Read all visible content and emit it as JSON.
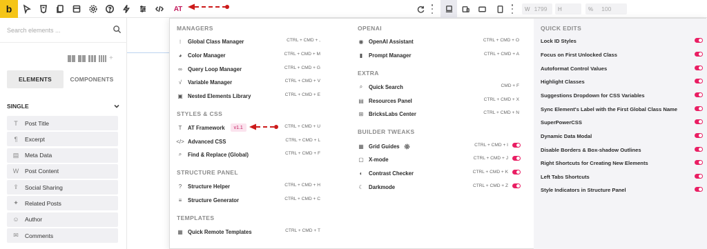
{
  "toolbar": {
    "logo": "b",
    "at_label": "AT",
    "width_label": "W",
    "width_value": "1799",
    "height_label": "H",
    "scale_label": "%",
    "scale_value": "100"
  },
  "sidebar": {
    "search_placeholder": "Search elements ...",
    "tabs": [
      "ELEMENTS",
      "COMPONENTS"
    ],
    "section_title": "SINGLE",
    "items": [
      {
        "label": "Post Title",
        "icon": "T"
      },
      {
        "label": "Excerpt",
        "icon": "¶"
      },
      {
        "label": "Meta Data",
        "icon": "▤"
      },
      {
        "label": "Post Content",
        "icon": "W"
      },
      {
        "label": "Social Sharing",
        "icon": "⇪"
      },
      {
        "label": "Related Posts",
        "icon": "✦"
      },
      {
        "label": "Author",
        "icon": "☺"
      },
      {
        "label": "Comments",
        "icon": "✉"
      }
    ]
  },
  "menu": {
    "managers": {
      "title": "MANAGERS",
      "items": [
        {
          "label": "Global Class Manager",
          "shortcut": "CTRL + CMD + ,",
          "icon": "⁝"
        },
        {
          "label": "Color Manager",
          "shortcut": "CTRL + CMD + M",
          "icon": "◕"
        },
        {
          "label": "Query Loop Manager",
          "shortcut": "CTRL + CMD + G",
          "icon": "∞"
        },
        {
          "label": "Variable Manager",
          "shortcut": "CTRL + CMD + V",
          "icon": "√"
        },
        {
          "label": "Nested Elements Library",
          "shortcut": "CTRL + CMD + E",
          "icon": "▣"
        }
      ]
    },
    "styles": {
      "title": "STYLES & CSS",
      "items": [
        {
          "label": "AT Framework",
          "shortcut": "CTRL + CMD + U",
          "icon": "T",
          "badge": "v1.1"
        },
        {
          "label": "Advanced CSS",
          "shortcut": "CTRL + CMD + L",
          "icon": "</>"
        },
        {
          "label": "Find & Replace (Global)",
          "shortcut": "CTRL + CMD + F",
          "icon": "⌕"
        }
      ]
    },
    "structure": {
      "title": "STRUCTURE PANEL",
      "items": [
        {
          "label": "Structure Helper",
          "shortcut": "CTRL + CMD + H",
          "icon": "?"
        },
        {
          "label": "Structure Generator",
          "shortcut": "CTRL + CMD + C",
          "icon": "≡"
        }
      ]
    },
    "templates": {
      "title": "TEMPLATES",
      "items": [
        {
          "label": "Quick Remote Templates",
          "shortcut": "CTRL + CMD + T",
          "icon": "▦"
        }
      ]
    },
    "openai": {
      "title": "OPENAI",
      "items": [
        {
          "label": "OpenAI Assistant",
          "shortcut": "CTRL + CMD + O",
          "icon": "◉"
        },
        {
          "label": "Prompt Manager",
          "shortcut": "CTRL + CMD + A",
          "icon": "▮"
        }
      ]
    },
    "extra": {
      "title": "EXTRA",
      "items": [
        {
          "label": "Quick Search",
          "shortcut": "CMD + F",
          "icon": "⌕"
        },
        {
          "label": "Resources Panel",
          "shortcut": "CTRL + CMD + X",
          "icon": "▤"
        },
        {
          "label": "BricksLabs Center",
          "shortcut": "CTRL + CMD + N",
          "icon": "⊞"
        }
      ]
    },
    "builder": {
      "title": "BUILDER TWEAKS",
      "items": [
        {
          "label": "Grid Guides",
          "shortcut": "CTRL + CMD + I",
          "icon": "▦",
          "gear": true
        },
        {
          "label": "X-mode",
          "shortcut": "CTRL + CMD + J",
          "icon": "▢"
        },
        {
          "label": "Contrast Checker",
          "shortcut": "CTRL + CMD + K",
          "icon": "◐"
        },
        {
          "label": "Darkmode",
          "shortcut": "CTRL + CMD + Z",
          "icon": "☾"
        }
      ]
    },
    "quick": {
      "title": "QUICK EDITS",
      "items": [
        "Lock ID Styles",
        "Focus on First Unlocked Class",
        "Autoformat Control Values",
        "Highlight Classes",
        "Suggestions Dropdown for CSS Variables",
        "Sync Element's Label with the First Global Class Name",
        "SuperPowerCSS",
        "Dynamic Data Modal",
        "Disable Borders & Box-shadow Outlines",
        "Right Shortcuts for Creating New Elements",
        "Left Tabs Shortcuts",
        "Style Indicators in Structure Panel"
      ]
    }
  },
  "colors": {
    "accent": "#e91e63",
    "logo_bg": "#f5c518",
    "annotation": "#cc1a1a"
  }
}
